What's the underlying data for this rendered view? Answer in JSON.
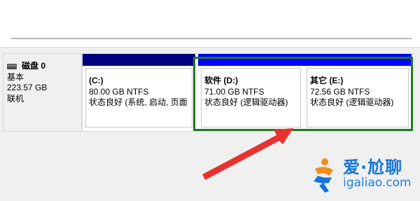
{
  "disk": {
    "name": "磁盘 0",
    "type": "基本",
    "size": "223.57 GB",
    "status": "联机"
  },
  "partitions": [
    {
      "label": "(C:)",
      "capacity": "80.00 GB NTFS",
      "status": "状态良好 (系统, 启动, 页面"
    },
    {
      "label": "软件  (D:)",
      "capacity": "71.00 GB NTFS",
      "status": "状态良好 (逻辑驱动器)"
    },
    {
      "label": "其它  (E:)",
      "capacity": "72.56 GB NTFS",
      "status": "状态良好 (逻辑驱动器)"
    }
  ],
  "colors": {
    "primary_bar": "#00007d",
    "logical_bar": "#0000ff",
    "highlight_frame": "#1f7a1f",
    "annotation_arrow": "#e8322f"
  },
  "watermark": {
    "cn": "爱·尬聊",
    "en": "igaliao.com"
  }
}
